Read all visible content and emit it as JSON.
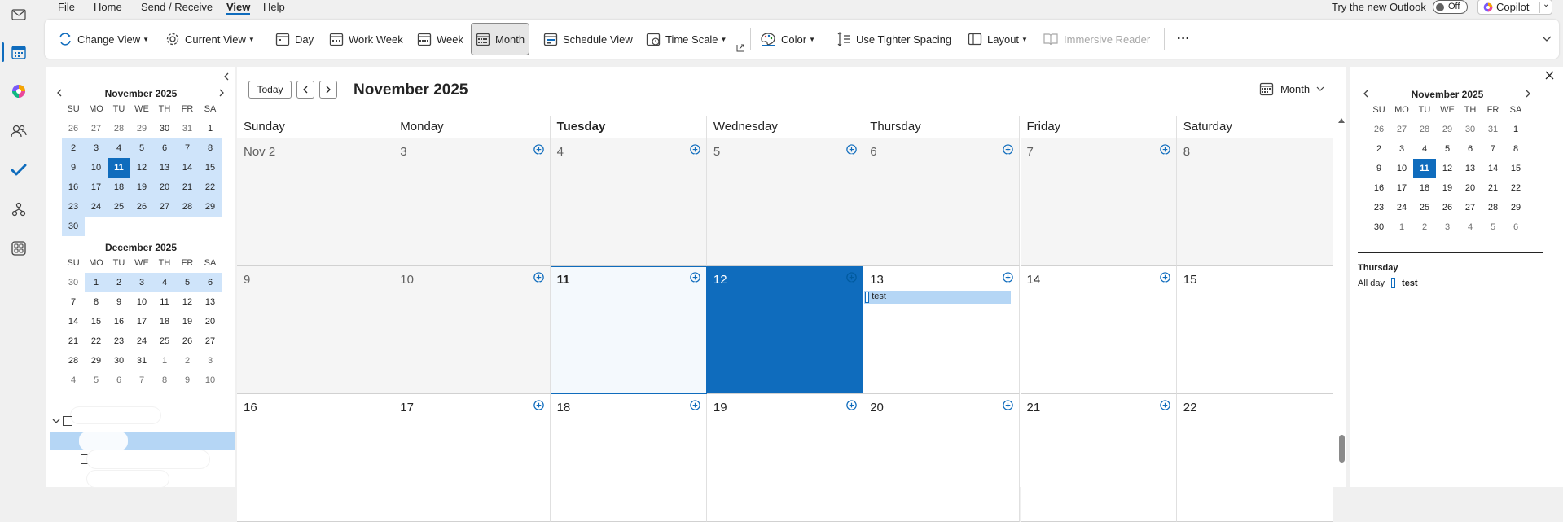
{
  "menu": {
    "items": [
      "File",
      "Home",
      "Send / Receive",
      "View",
      "Help"
    ],
    "active": "View",
    "try_new_outlook": "Try the new Outlook",
    "toggle_state": "Off",
    "copilot_label": "Copilot"
  },
  "ribbon": {
    "change_view": "Change View",
    "current_view": "Current View",
    "day": "Day",
    "work_week": "Work Week",
    "week": "Week",
    "month": "Month",
    "schedule_view": "Schedule View",
    "time_scale": "Time Scale",
    "color": "Color",
    "tighter_spacing": "Use Tighter Spacing",
    "layout": "Layout",
    "immersive_reader": "Immersive Reader",
    "more": "···"
  },
  "nav_pane": {
    "calendars": [
      {
        "title": "November 2025",
        "weekdays": [
          "SU",
          "MO",
          "TU",
          "WE",
          "TH",
          "FR",
          "SA"
        ],
        "weeks": [
          [
            "26",
            "27",
            "28",
            "29",
            "30",
            "31",
            "1"
          ],
          [
            "2",
            "3",
            "4",
            "5",
            "6",
            "7",
            "8"
          ],
          [
            "9",
            "10",
            "11",
            "12",
            "13",
            "14",
            "15"
          ],
          [
            "16",
            "17",
            "18",
            "19",
            "20",
            "21",
            "22"
          ],
          [
            "23",
            "24",
            "25",
            "26",
            "27",
            "28",
            "29"
          ],
          [
            "30"
          ]
        ]
      },
      {
        "title": "December 2025",
        "weekdays": [
          "SU",
          "MO",
          "TU",
          "WE",
          "TH",
          "FR",
          "SA"
        ],
        "weeks": [
          [
            "30",
            "1",
            "2",
            "3",
            "4",
            "5",
            "6"
          ],
          [
            "7",
            "8",
            "9",
            "10",
            "11",
            "12",
            "13"
          ],
          [
            "14",
            "15",
            "16",
            "17",
            "18",
            "19",
            "20"
          ],
          [
            "21",
            "22",
            "23",
            "24",
            "25",
            "26",
            "27"
          ],
          [
            "28",
            "29",
            "30",
            "31",
            "1",
            "2",
            "3"
          ],
          [
            "4",
            "5",
            "6",
            "7",
            "8",
            "9",
            "10"
          ]
        ]
      }
    ]
  },
  "main": {
    "today_label": "Today",
    "title": "November 2025",
    "view_label": "Month",
    "day_headers": [
      "Sunday",
      "Monday",
      "Tuesday",
      "Wednesday",
      "Thursday",
      "Friday",
      "Saturday"
    ],
    "today_header": "Tuesday",
    "weeks": [
      [
        "Nov 2",
        "3",
        "4",
        "5",
        "6",
        "7",
        "8"
      ],
      [
        "9",
        "10",
        "11",
        "12",
        "13",
        "14",
        "15"
      ],
      [
        "16",
        "17",
        "18",
        "19",
        "20",
        "21",
        "22"
      ]
    ],
    "event": {
      "title": "test",
      "day": "13"
    }
  },
  "right_pane": {
    "calendar": {
      "title": "November 2025",
      "weekdays": [
        "SU",
        "MO",
        "TU",
        "WE",
        "TH",
        "FR",
        "SA"
      ],
      "weeks": [
        [
          "26",
          "27",
          "28",
          "29",
          "30",
          "31",
          "1"
        ],
        [
          "2",
          "3",
          "4",
          "5",
          "6",
          "7",
          "8"
        ],
        [
          "9",
          "10",
          "11",
          "12",
          "13",
          "14",
          "15"
        ],
        [
          "16",
          "17",
          "18",
          "19",
          "20",
          "21",
          "22"
        ],
        [
          "23",
          "24",
          "25",
          "26",
          "27",
          "28",
          "29"
        ],
        [
          "30",
          "1",
          "2",
          "3",
          "4",
          "5",
          "6"
        ]
      ]
    },
    "agenda_day": "Thursday",
    "agenda_allday": "All day",
    "agenda_event": "test"
  },
  "colors": {
    "accent": "#0f6cbd",
    "highlight": "#cfe4fa",
    "event": "#b5d6f5"
  }
}
